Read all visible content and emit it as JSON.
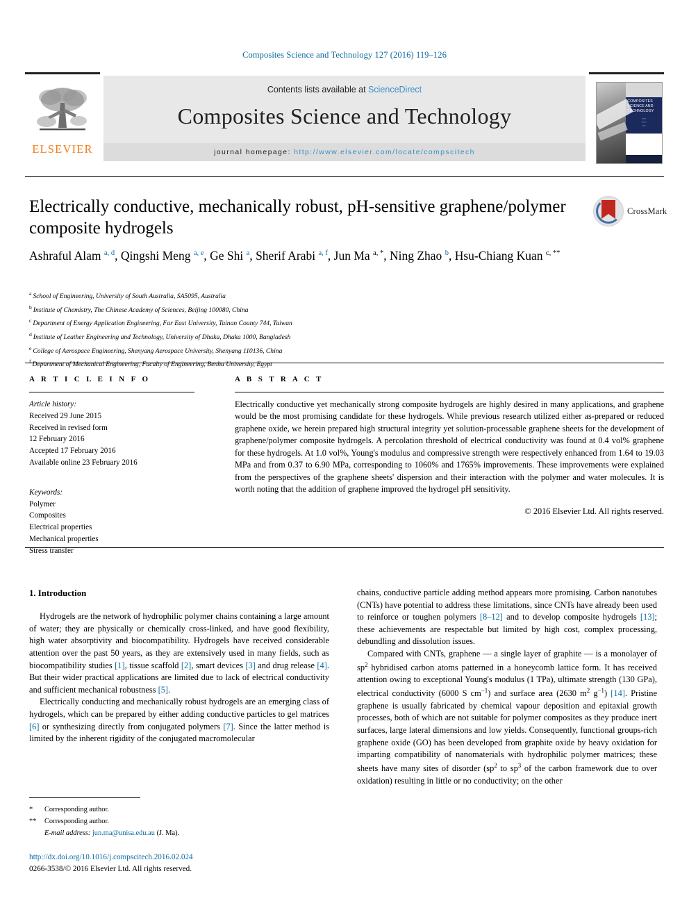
{
  "running_head": "Composites Science and Technology 127 (2016) 119–126",
  "masthead": {
    "contents_prefix": "Contents lists available at ",
    "sciencedirect": "ScienceDirect",
    "journal_title": "Composites Science and Technology",
    "homepage_label": "journal homepage:",
    "homepage_url": "http://www.elsevier.com/locate/compscitech",
    "elsevier_wordmark": "ELSEVIER",
    "cover_title_lines": [
      "COMPOSITES",
      "SCIENCE AND",
      "TECHNOLOGY"
    ],
    "link_color": "#3a8fc4",
    "elsevier_orange": "#f07c1a"
  },
  "article": {
    "title": "Electrically conductive, mechanically robust, pH-sensitive graphene/polymer composite hydrogels",
    "crossmark_label": "CrossMark",
    "authors": [
      {
        "name": "Ashraful Alam",
        "marks": "a, d",
        "sep": ","
      },
      {
        "name": "Qingshi Meng",
        "marks": "a, e",
        "sep": ","
      },
      {
        "name": "Ge Shi",
        "marks": "a",
        "sep": ","
      },
      {
        "name": "Sherif Arabi",
        "marks": "a, f",
        "sep": ","
      },
      {
        "name": "Jun Ma",
        "marks": "a, *",
        "sep": ","
      },
      {
        "name": "Ning Zhao",
        "marks": "b",
        "sep": ","
      },
      {
        "name": "Hsu-Chiang Kuan",
        "marks": "c, **",
        "sep": ""
      }
    ],
    "affiliations": [
      {
        "mark": "a",
        "text": "School of Engineering, University of South Australia, SA5095, Australia"
      },
      {
        "mark": "b",
        "text": "Institute of Chemistry, The Chinese Academy of Sciences, Beijing 100080, China"
      },
      {
        "mark": "c",
        "text": "Department of Energy Application Engineering, Far East University, Tainan County 744, Taiwan"
      },
      {
        "mark": "d",
        "text": "Institute of Leather Engineering and Technology, University of Dhaka, Dhaka 1000, Bangladesh"
      },
      {
        "mark": "e",
        "text": "College of Aerospace Engineering, Shenyang Aerospace University, Shenyang 110136, China"
      },
      {
        "mark": "f",
        "text": "Department of Mechanical Engineering, Faculty of Engineering, Benha University, Egypt"
      }
    ]
  },
  "article_info": {
    "heading": "A R T I C L E  I N F O",
    "history_label": "Article history:",
    "history": [
      "Received 29 June 2015",
      "Received in revised form",
      "12 February 2016",
      "Accepted 17 February 2016",
      "Available online 23 February 2016"
    ],
    "keywords_label": "Keywords:",
    "keywords": [
      "Polymer",
      "Composites",
      "Electrical properties",
      "Mechanical properties",
      "Stress transfer"
    ]
  },
  "abstract": {
    "heading": "A B S T R A C T",
    "text": "Electrically conductive yet mechanically strong composite hydrogels are highly desired in many applications, and graphene would be the most promising candidate for these hydrogels. While previous research utilized either as-prepared or reduced graphene oxide, we herein prepared high structural integrity yet solution-processable graphene sheets for the development of graphene/polymer composite hydrogels. A percolation threshold of electrical conductivity was found at 0.4 vol% graphene for these hydrogels. At 1.0 vol%, Young's modulus and compressive strength were respectively enhanced from 1.64 to 19.03 MPa and from 0.37 to 6.90 MPa, corresponding to 1060% and 1765% improvements. These improvements were explained from the perspectives of the graphene sheets' dispersion and their interaction with the polymer and water molecules. It is worth noting that the addition of graphene improved the hydrogel pH sensitivity.",
    "copyright": "© 2016 Elsevier Ltd. All rights reserved."
  },
  "body": {
    "section_number_title": "1.  Introduction",
    "left_paragraphs": [
      {
        "segments": [
          {
            "t": "Hydrogels are the network of hydrophilic polymer chains containing a large amount of water; they are physically or chemically cross-linked, and have good flexibility, high water absorptivity and biocompatibility. Hydrogels have received considerable attention over the past 50 years, as they are extensively used in many fields, such as biocompatibility studies "
          },
          {
            "t": "[1]",
            "ref": true
          },
          {
            "t": ", tissue scaffold "
          },
          {
            "t": "[2]",
            "ref": true
          },
          {
            "t": ", smart devices "
          },
          {
            "t": "[3]",
            "ref": true
          },
          {
            "t": " and drug release "
          },
          {
            "t": "[4]",
            "ref": true
          },
          {
            "t": ". But their wider practical applications are limited due to lack of electrical conductivity and sufficient mechanical robustness "
          },
          {
            "t": "[5]",
            "ref": true
          },
          {
            "t": "."
          }
        ]
      },
      {
        "segments": [
          {
            "t": "Electrically conducting and mechanically robust hydrogels are an emerging class of hydrogels, which can be prepared by either adding conductive particles to gel matrices "
          },
          {
            "t": "[6]",
            "ref": true
          },
          {
            "t": " or synthesizing directly from conjugated polymers "
          },
          {
            "t": "[7]",
            "ref": true
          },
          {
            "t": ". Since the latter method is limited by the inherent rigidity of the conjugated macromolecular"
          }
        ]
      }
    ],
    "right_paragraphs": [
      {
        "indent": false,
        "segments": [
          {
            "t": "chains, conductive particle adding method appears more promising. Carbon nanotubes (CNTs) have potential to address these limitations, since CNTs have already been used to reinforce or toughen polymers "
          },
          {
            "t": "[8–12]",
            "ref": true
          },
          {
            "t": " and to develop composite hydrogels "
          },
          {
            "t": "[13]",
            "ref": true
          },
          {
            "t": "; these achievements are respectable but limited by high cost, complex processing, debundling and dissolution issues."
          }
        ]
      },
      {
        "indent": true,
        "segments": [
          {
            "t": "Compared with CNTs, graphene — a single layer of graphite — is a monolayer of sp"
          },
          {
            "t": "2",
            "sup": true
          },
          {
            "t": " hybridised carbon atoms patterned in a honeycomb lattice form. It has received attention owing to exceptional Young's modulus (1 TPa), ultimate strength (130 GPa), electrical conductivity (6000 S cm"
          },
          {
            "t": "−1",
            "sup": true
          },
          {
            "t": ") and surface area (2630 m"
          },
          {
            "t": "2",
            "sup": true
          },
          {
            "t": " g"
          },
          {
            "t": "−1",
            "sup": true
          },
          {
            "t": ") "
          },
          {
            "t": "[14]",
            "ref": true
          },
          {
            "t": ". Pristine graphene is usually fabricated by chemical vapour deposition and epitaxial growth processes, both of which are not suitable for polymer composites as they produce inert surfaces, large lateral dimensions and low yields. Consequently, functional groups-rich graphene oxide (GO) has been developed from graphite oxide by heavy oxidation for imparting compatibility of nanomaterials with hydrophilic polymer matrices; these sheets have many sites of disorder (sp"
          },
          {
            "t": "2",
            "sup": true
          },
          {
            "t": " to sp"
          },
          {
            "t": "3",
            "sup": true
          },
          {
            "t": " of the carbon framework due to over oxidation) resulting in little or no conductivity; on the other"
          }
        ]
      }
    ]
  },
  "footnotes": {
    "corresponding_1_mark": "*",
    "corresponding_1": "Corresponding author.",
    "corresponding_2_mark": "**",
    "corresponding_2": "Corresponding author.",
    "email_label": "E-mail address:",
    "email": "jun.ma@unisa.edu.au",
    "email_suffix": "(J. Ma)."
  },
  "footer": {
    "doi": "http://dx.doi.org/10.1016/j.compscitech.2016.02.024",
    "issn_line": "0266-3538/© 2016 Elsevier Ltd. All rights reserved."
  }
}
